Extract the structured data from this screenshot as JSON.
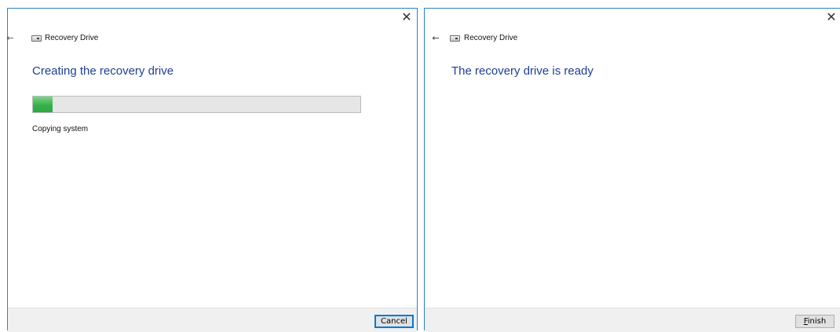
{
  "left_window": {
    "close_glyph": "✕",
    "back_glyph": "←",
    "drive_icon": "drive-icon",
    "app_title": "Recovery Drive",
    "heading": "Creating the recovery drive",
    "progress_percent": 6,
    "progress_color": "#37b24a",
    "status": "Copying system",
    "cancel_label": "Cancel"
  },
  "right_window": {
    "close_glyph": "✕",
    "back_glyph": "←",
    "drive_icon": "drive-icon",
    "app_title": "Recovery Drive",
    "heading": "The recovery drive is ready",
    "finish_mnemonic": "F",
    "finish_rest": "inish"
  },
  "colors": {
    "accent_border": "#2f80c8",
    "heading_text": "#1e3f93",
    "footer_bg": "#f0f0f0"
  }
}
